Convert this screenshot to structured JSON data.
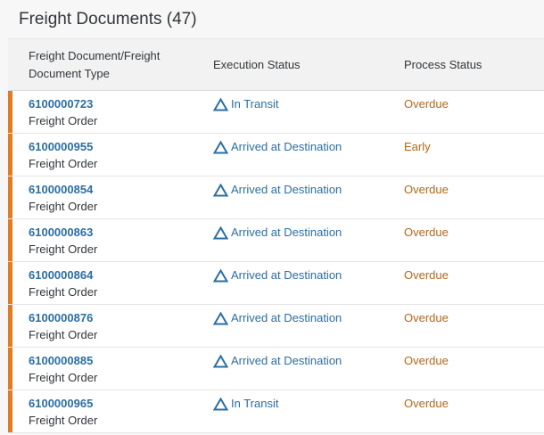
{
  "header": {
    "title": "Freight Documents (47)"
  },
  "table": {
    "columns": [
      "Freight Document/Freight Document Type",
      "Execution Status",
      "Process Status"
    ],
    "rows": [
      {
        "doc_id": "6100000723",
        "doc_type": "Freight Order",
        "execution_status": "In Transit",
        "process_status": "Overdue"
      },
      {
        "doc_id": "6100000955",
        "doc_type": "Freight Order",
        "execution_status": "Arrived at Destination",
        "process_status": "Early"
      },
      {
        "doc_id": "6100000854",
        "doc_type": "Freight Order",
        "execution_status": "Arrived at Destination",
        "process_status": "Overdue"
      },
      {
        "doc_id": "6100000863",
        "doc_type": "Freight Order",
        "execution_status": "Arrived at Destination",
        "process_status": "Overdue"
      },
      {
        "doc_id": "6100000864",
        "doc_type": "Freight Order",
        "execution_status": "Arrived at Destination",
        "process_status": "Overdue"
      },
      {
        "doc_id": "6100000876",
        "doc_type": "Freight Order",
        "execution_status": "Arrived at Destination",
        "process_status": "Overdue"
      },
      {
        "doc_id": "6100000885",
        "doc_type": "Freight Order",
        "execution_status": "Arrived at Destination",
        "process_status": "Overdue"
      },
      {
        "doc_id": "6100000965",
        "doc_type": "Freight Order",
        "execution_status": "In Transit",
        "process_status": "Overdue"
      }
    ]
  },
  "icons": {
    "execution_status_icon": "triangle-outline-icon"
  },
  "colors": {
    "row_highlight": "#e17b24",
    "link": "#2b6ea3",
    "process_status": "#b4671a"
  }
}
